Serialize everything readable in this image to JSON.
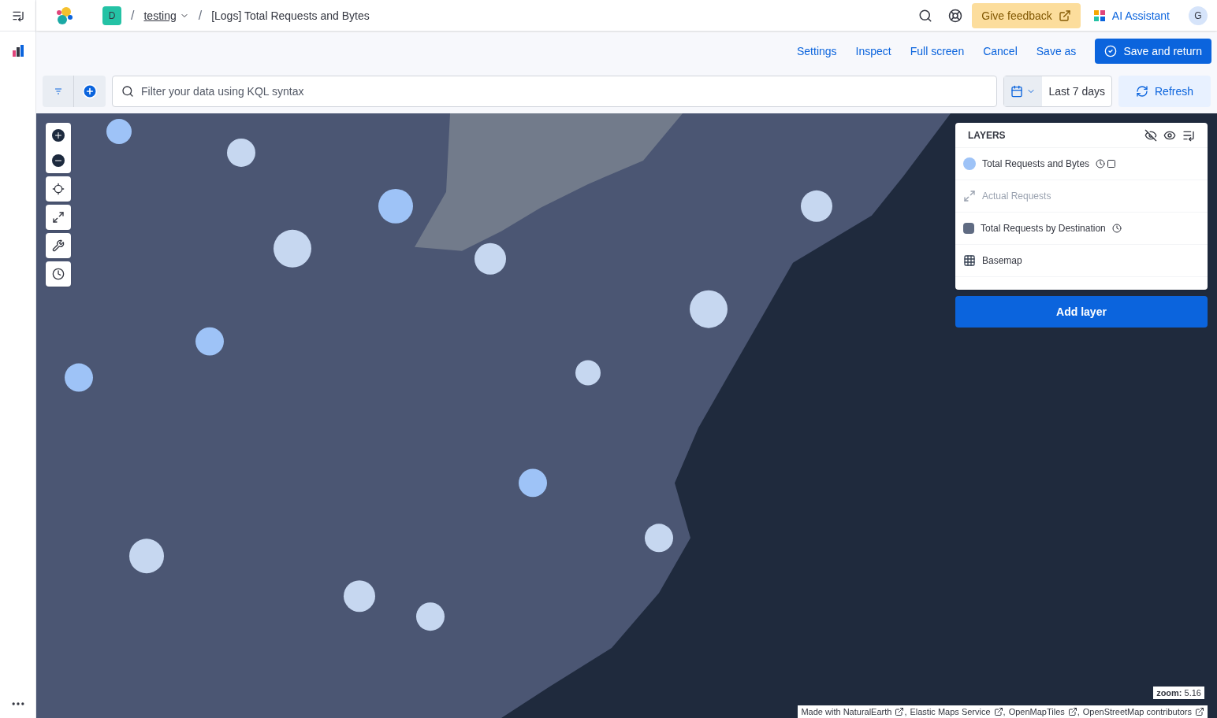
{
  "header": {
    "space_initial": "D",
    "breadcrumb_separator": "/",
    "breadcrumbs": [
      {
        "label": "testing",
        "link": true
      },
      {
        "label": "[Logs] Total Requests and Bytes",
        "link": false
      }
    ],
    "feedback": "Give feedback",
    "assistant": "AI Assistant",
    "user_initial": "G"
  },
  "actions": [
    {
      "label": "Settings",
      "kind": "link"
    },
    {
      "label": "Inspect",
      "kind": "link"
    },
    {
      "label": "Full screen",
      "kind": "link"
    },
    {
      "label": "Cancel",
      "kind": "link"
    },
    {
      "label": "Save as",
      "kind": "link"
    },
    {
      "label": "Save and return",
      "kind": "primary"
    }
  ],
  "query": {
    "placeholder": "Filter your data using KQL syntax",
    "date_range": "Last 7 days",
    "refresh": "Refresh"
  },
  "map": {
    "layers_title": "LAYERS",
    "layers": [
      {
        "kind": "circle",
        "label": "Total Requests and Bytes",
        "color": "#9ec3f7",
        "hidden": false,
        "clock": true,
        "square_icon": true
      },
      {
        "kind": "resize",
        "label": "Actual Requests",
        "hidden": true,
        "clock": false,
        "square_icon": false
      },
      {
        "kind": "square",
        "label": "Total Requests by Destination",
        "color": "#5f6b82",
        "hidden": false,
        "clock": true,
        "square_icon": false
      },
      {
        "kind": "grid",
        "label": "Basemap",
        "hidden": false,
        "clock": false,
        "square_icon": false
      }
    ],
    "add_layer": "Add layer",
    "zoom_label": "zoom:",
    "zoom_value": "5.16",
    "attribution_separator": ",",
    "attribution": [
      "Made with NaturalEarth",
      "Elastic Maps Service",
      "OpenMapTiles",
      "OpenStreetMap contributors"
    ]
  }
}
